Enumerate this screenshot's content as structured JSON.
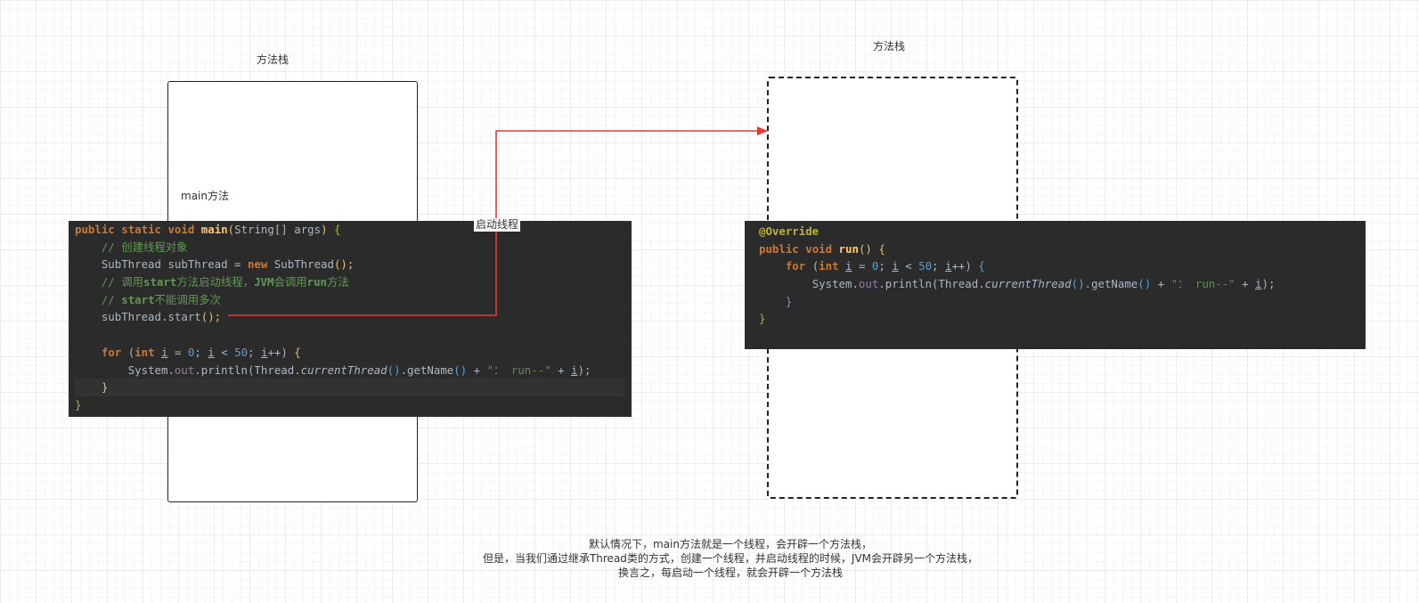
{
  "left_stack": {
    "title": "方法栈",
    "frame_label": "main方法"
  },
  "right_stack": {
    "title": "方法栈"
  },
  "arrow": {
    "label": "启动线程",
    "color": "#e53935"
  },
  "main_code": {
    "l1_kw1": "public",
    "l1_kw2": "static",
    "l1_kw3": "void",
    "l1_fn": "main",
    "l1_p1": "(",
    "l1_type": "String[] args",
    "l1_p2": ")",
    "l1_b": "{",
    "l2_comment": "// 创建线程对象",
    "l3_text1": "SubThread subThread = ",
    "l3_kw": "new",
    "l3_text2": " SubThread",
    "l3_p": "();",
    "l4_c1": "// 调用",
    "l4_c2": "start",
    "l4_c3": "方法启动线程，",
    "l4_c4": "JVM",
    "l4_c5": "会调用",
    "l4_c6": "run",
    "l4_c7": "方法",
    "l5_c1": "// ",
    "l5_c2": "start",
    "l5_c3": "不能调用多次",
    "l6_text": "subThread.start",
    "l6_p": "();",
    "l8_kw1": "for",
    "l8_p1": " (",
    "l8_kw2": "int",
    "l8_v1": "i",
    "l8_t1": " = ",
    "l8_n1": "0",
    "l8_t2": "; ",
    "l8_v2": "i",
    "l8_t3": " < ",
    "l8_n2": "50",
    "l8_t4": "; ",
    "l8_v3": "i",
    "l8_t5": "++) ",
    "l8_b": "{",
    "l9_t1": "System.",
    "l9_fld": "out",
    "l9_t2": ".println(Thread.",
    "l9_it": "currentThread",
    "l9_p1": "()",
    "l9_t3": ".getName",
    "l9_p2": "()",
    "l9_t4": " + ",
    "l9_str": "\"： run--\"",
    "l9_t5": " + ",
    "l9_v": "i",
    "l9_t6": ");",
    "l10_b": "}",
    "l11_b": "}"
  },
  "run_code": {
    "l1_an": "@Override",
    "l2_kw1": "public",
    "l2_kw2": "void",
    "l2_fn": "run",
    "l2_p": "()",
    "l2_b": "{",
    "l3_kw1": "for",
    "l3_p1": " (",
    "l3_kw2": "int",
    "l3_v1": "i",
    "l3_t1": " = ",
    "l3_n1": "0",
    "l3_t2": "; ",
    "l3_v2": "i",
    "l3_t3": " < ",
    "l3_n2": "50",
    "l3_t4": "; ",
    "l3_v3": "i",
    "l3_t5": "++) ",
    "l3_b": "{",
    "l4_t1": "System.",
    "l4_fld": "out",
    "l4_t2": ".println(Thread.",
    "l4_it": "currentThread",
    "l4_p1": "()",
    "l4_t3": ".getName",
    "l4_p2": "()",
    "l4_t4": " + ",
    "l4_str": "\"： run--\"",
    "l4_t5": " + ",
    "l4_v": "i",
    "l4_t6": ");",
    "l5_b": "}",
    "l6_b": "}"
  },
  "caption": {
    "line1": "默认情况下，main方法就是一个线程，会开辟一个方法栈，",
    "line2": "但是，当我们通过继承Thread类的方式，创建一个线程，并启动线程的时候，JVM会开辟另一个方法栈，",
    "line3": "换言之，每启动一个线程，就会开辟一个方法栈"
  }
}
